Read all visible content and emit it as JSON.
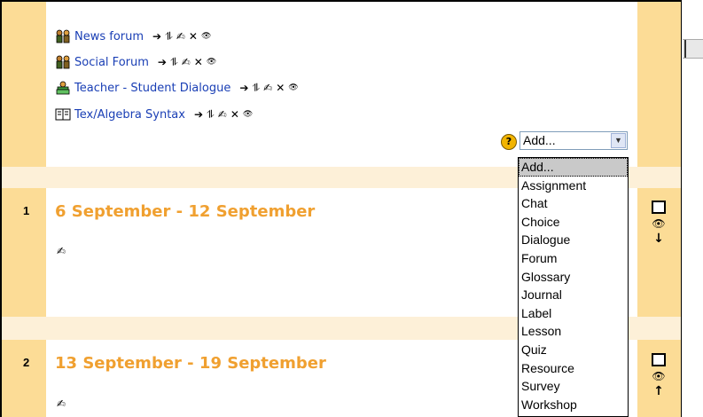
{
  "activities": [
    {
      "name": "News forum",
      "icon": "forum-icon"
    },
    {
      "name": "Social Forum",
      "icon": "forum-icon"
    },
    {
      "name": "Teacher - Student Dialogue",
      "icon": "dialogue-icon"
    },
    {
      "name": "Tex/Algebra Syntax",
      "icon": "resource-icon"
    }
  ],
  "controls": {
    "move": "➔",
    "move_updown": "⥮",
    "edit": "✍",
    "delete": "✕",
    "hide": "👁"
  },
  "add_select": {
    "selected": "Add...",
    "help_symbol": "?",
    "arrow": "▼"
  },
  "dropdown": {
    "options": [
      "Add...",
      "Assignment",
      "Chat",
      "Choice",
      "Dialogue",
      "Forum",
      "Glossary",
      "Journal",
      "Label",
      "Lesson",
      "Quiz",
      "Resource",
      "Survey",
      "Workshop"
    ]
  },
  "sections": [
    {
      "number": "1",
      "title": "6 September - 12 September",
      "edit": "✍",
      "arrow": "↓"
    },
    {
      "number": "2",
      "title": "13 September - 19 September",
      "edit": "✍",
      "arrow": "↑"
    }
  ],
  "colors": {
    "sidebar": "#fcdc96",
    "section_title": "#f0a030",
    "link": "#1a3fb5",
    "divider": "#fdf0d8"
  }
}
